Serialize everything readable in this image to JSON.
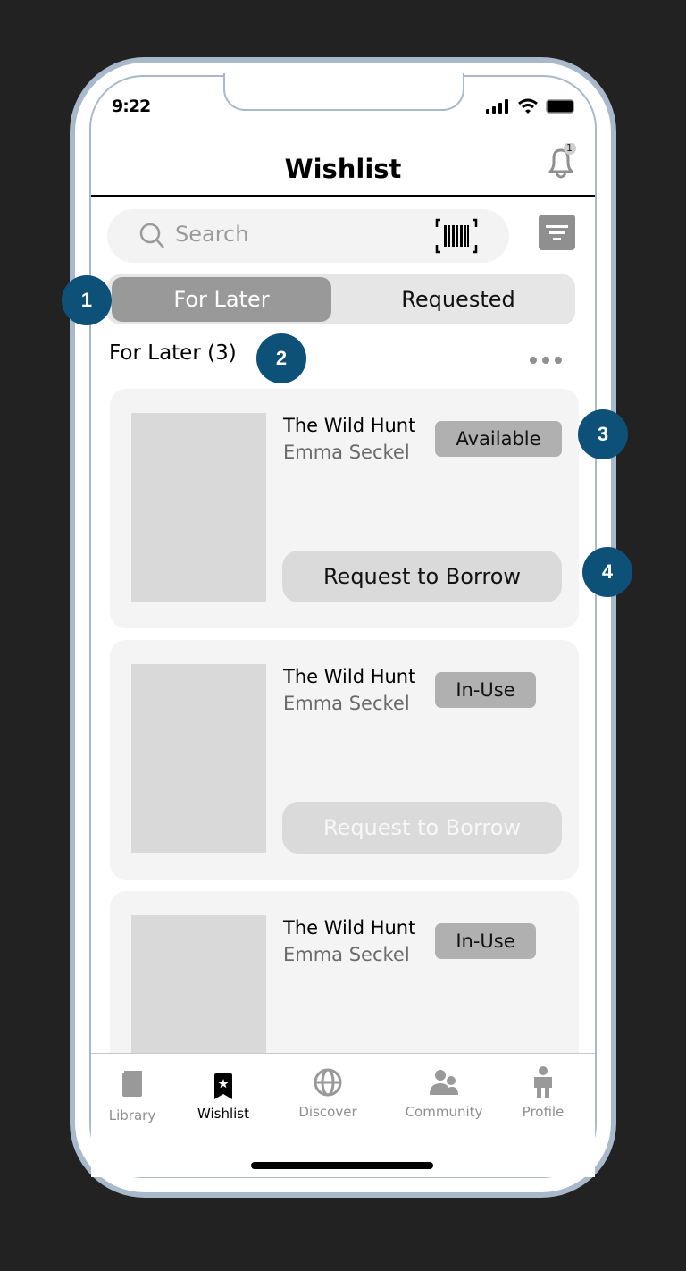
{
  "status_bar": {
    "time": "9:22"
  },
  "header": {
    "title": "Wishlist",
    "notification_count": "1"
  },
  "search": {
    "placeholder": "Search"
  },
  "segments": [
    {
      "label": "For Later",
      "active": true
    },
    {
      "label": "Requested",
      "active": false
    }
  ],
  "section": {
    "title": "For Later (3)"
  },
  "annotations": [
    "1",
    "2",
    "3",
    "4"
  ],
  "books": [
    {
      "title": "The Wild Hunt",
      "author": "Emma Seckel",
      "status": "Available",
      "action": "Request to Borrow",
      "action_enabled": true
    },
    {
      "title": "The Wild Hunt",
      "author": "Emma Seckel",
      "status": "In-Use",
      "action": "Request to Borrow",
      "action_enabled": false
    },
    {
      "title": "The Wild Hunt",
      "author": "Emma Seckel",
      "status": "In-Use"
    }
  ],
  "tabbar": {
    "items": [
      {
        "label": "Library",
        "icon": "book-icon",
        "active": false
      },
      {
        "label": "Wishlist",
        "icon": "bookmark-star-icon",
        "active": true
      },
      {
        "label": "Discover",
        "icon": "globe-icon",
        "active": false
      },
      {
        "label": "Community",
        "icon": "people-icon",
        "active": false
      },
      {
        "label": "Profile",
        "icon": "person-icon",
        "active": false
      }
    ]
  },
  "colors": {
    "annotation": "#0d5078",
    "frame": "#a9b9cc",
    "active_segment": "#999999"
  }
}
